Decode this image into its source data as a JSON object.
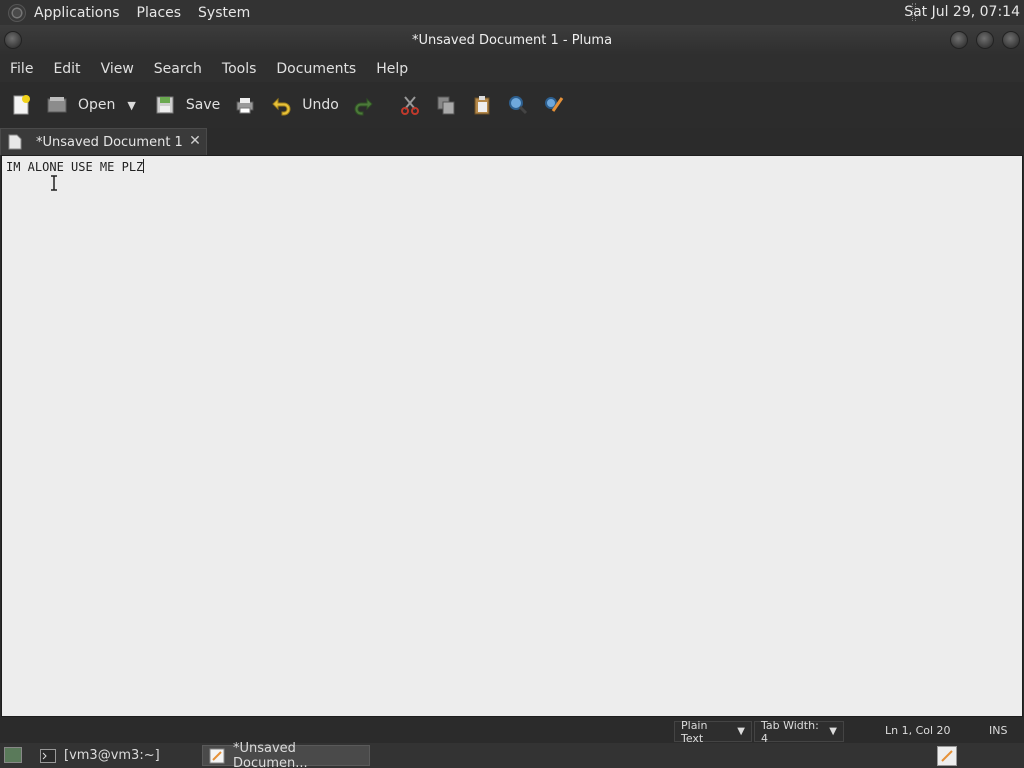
{
  "top_panel": {
    "menus": [
      "Applications",
      "Places",
      "System"
    ],
    "clock": "Sat Jul 29, 07:14"
  },
  "window": {
    "title": "*Unsaved Document 1 - Pluma"
  },
  "menu_bar": {
    "items": [
      "File",
      "Edit",
      "View",
      "Search",
      "Tools",
      "Documents",
      "Help"
    ]
  },
  "toolbar": {
    "open_label": "Open",
    "save_label": "Save",
    "undo_label": "Undo"
  },
  "tab": {
    "label": "*Unsaved Document 1",
    "close": "✕"
  },
  "editor": {
    "text": "IM ALONE USE ME PLZ"
  },
  "status_bar": {
    "syntax": "Plain Text",
    "tab_width": "Tab Width:  4",
    "position": "Ln 1, Col 20",
    "mode": "INS"
  },
  "taskbar": {
    "terminal_task": "[vm3@vm3:~]",
    "editor_task": "*Unsaved Documen..."
  }
}
